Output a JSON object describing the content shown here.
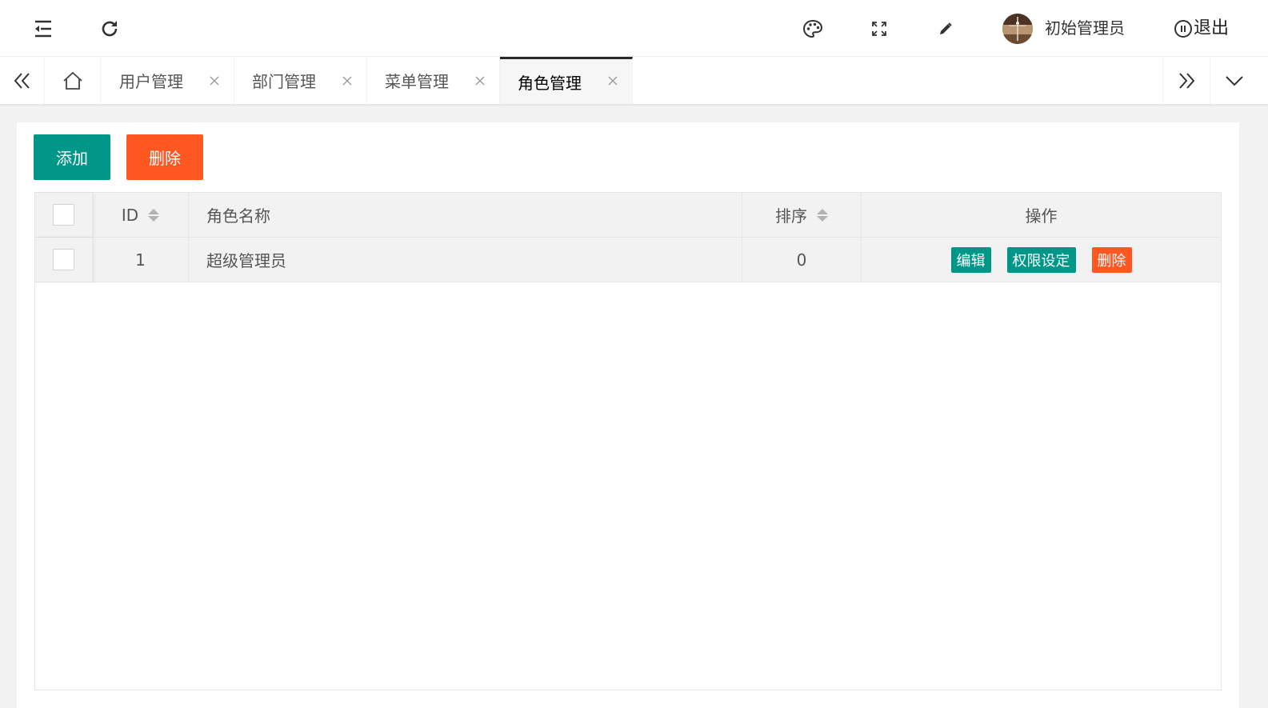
{
  "header": {
    "menu_icon": "indent-menu-icon",
    "refresh_icon": "refresh-icon",
    "theme_icon": "palette-icon",
    "fullscreen_icon": "fullscreen-icon",
    "edit_icon": "pencil-icon",
    "user_name": "初始管理员",
    "logout_label": "退出"
  },
  "tabs": {
    "items": [
      {
        "label": "用户管理"
      },
      {
        "label": "部门管理"
      },
      {
        "label": "菜单管理"
      },
      {
        "label": "角色管理",
        "active": true
      }
    ]
  },
  "toolbar": {
    "add_label": "添加",
    "delete_label": "删除"
  },
  "table": {
    "columns": [
      "ID",
      "角色名称",
      "排序",
      "操作"
    ],
    "rows": [
      {
        "id": "1",
        "name": "超级管理员",
        "sort": "0",
        "actions": [
          "编辑",
          "权限设定",
          "删除"
        ]
      }
    ]
  },
  "colors": {
    "primary": "#009688",
    "danger": "#ff5722"
  }
}
